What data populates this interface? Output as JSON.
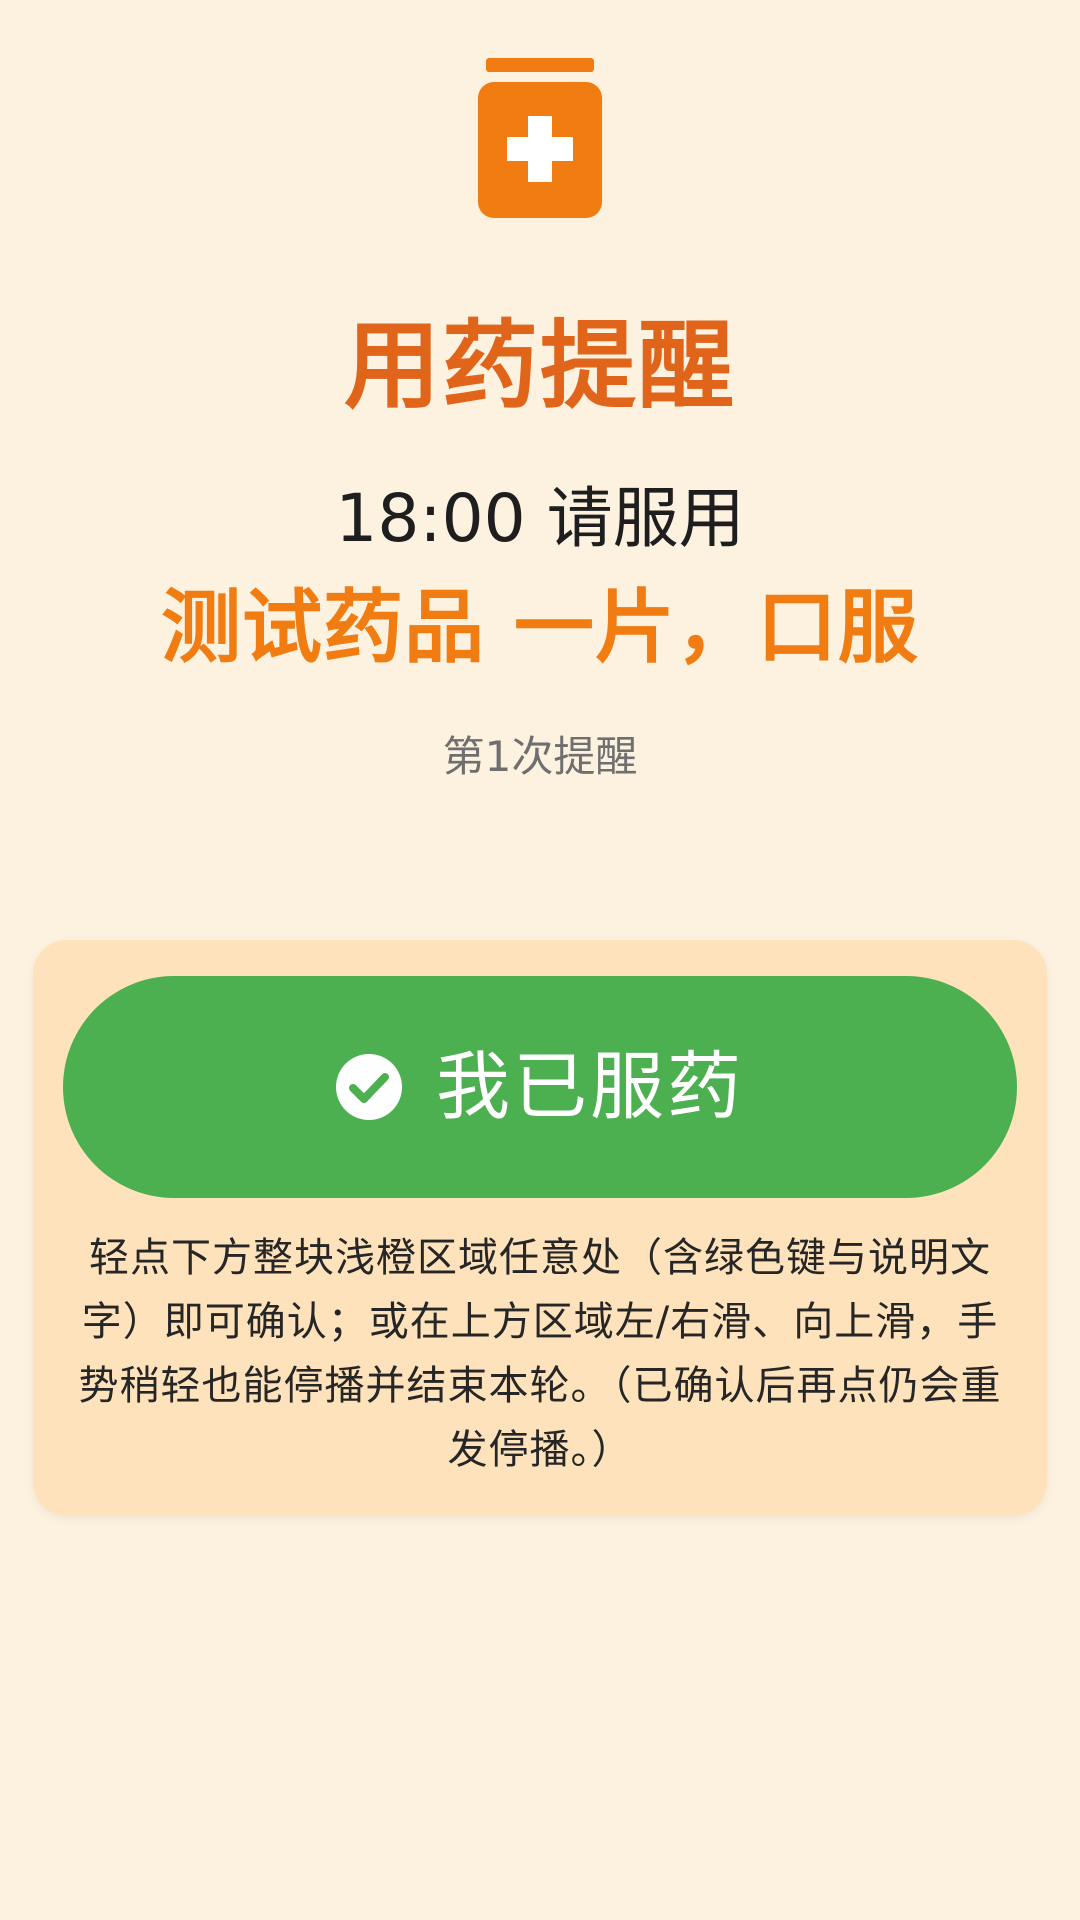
{
  "header": {
    "icon": "medicine-bottle-icon",
    "icon_color": "#f07c12",
    "title": "用药提醒"
  },
  "reminder": {
    "time_line": "18:00 请服用",
    "medicine_line": "测试药品 一片，口服",
    "count_line": "第1次提醒"
  },
  "panel": {
    "background": "#fde2bb",
    "confirm_button": {
      "icon": "check-circle-icon",
      "label": "我已服药",
      "color": "#4caf50"
    },
    "hint_text": "轻点下方整块浅橙区域任意处（含绿色键与说明文字）即可确认；或在上方区域左/右滑、向上滑，手势稍轻也能停播并结束本轮。（已确认后再点仍会重发停播。）"
  },
  "colors": {
    "background": "#fdf1e0",
    "title": "#e0651b",
    "medicine": "#f07c12",
    "text": "#1e1e1e",
    "muted": "#6f6f6f"
  }
}
